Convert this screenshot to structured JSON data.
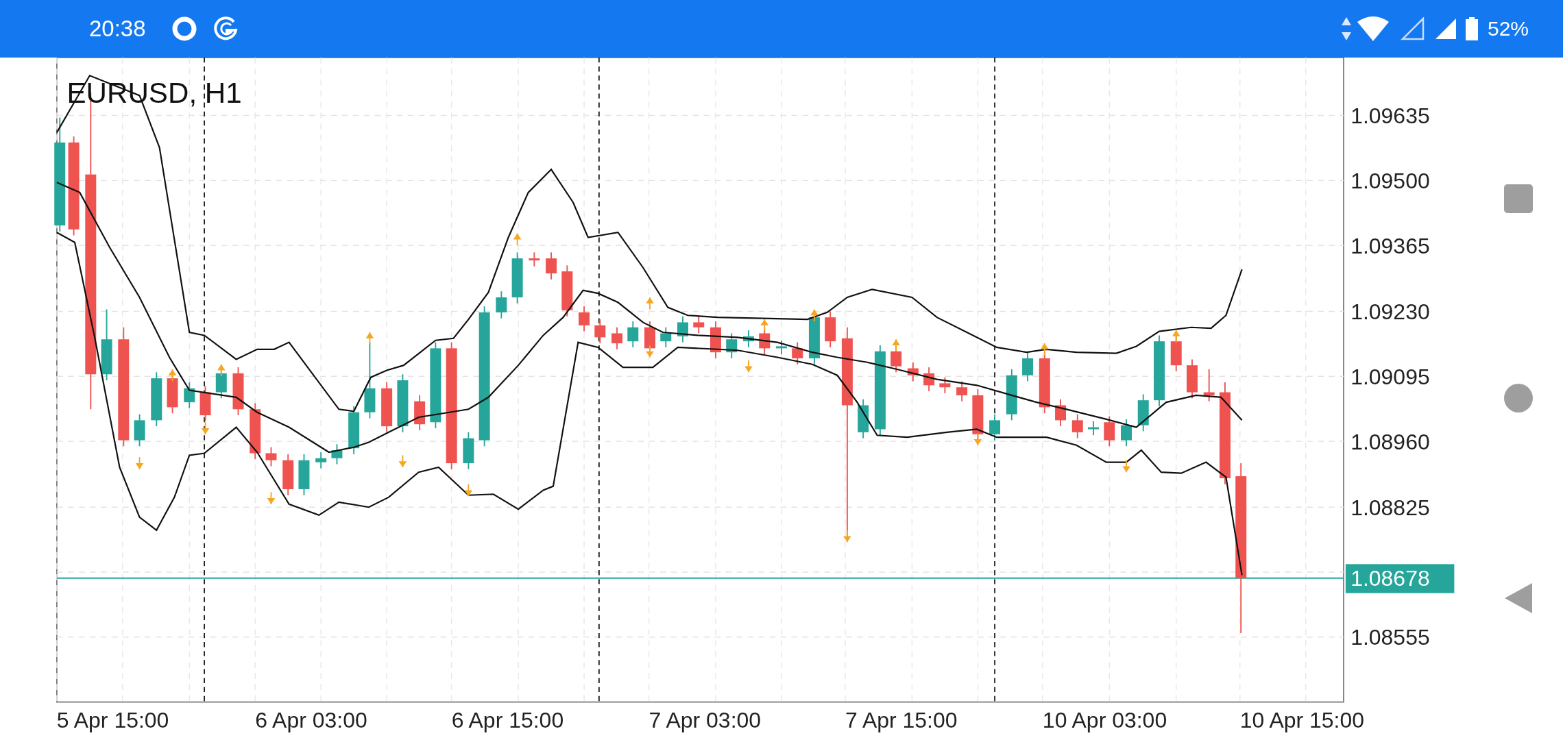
{
  "status_bar": {
    "time": "20:38",
    "battery": "52%"
  },
  "chart": {
    "title": "EURUSD, H1",
    "price_tag": "1.08678",
    "y_axis_labels": [
      "1.09635",
      "1.09500",
      "1.09365",
      "1.09230",
      "1.09095",
      "1.08960",
      "1.08825",
      "1.08555"
    ],
    "x_axis_labels": [
      "5 Apr 15:00",
      "6 Apr 03:00",
      "6 Apr 15:00",
      "7 Apr 03:00",
      "7 Apr 15:00",
      "10 Apr 03:00",
      "10 Apr 15:00"
    ]
  }
}
